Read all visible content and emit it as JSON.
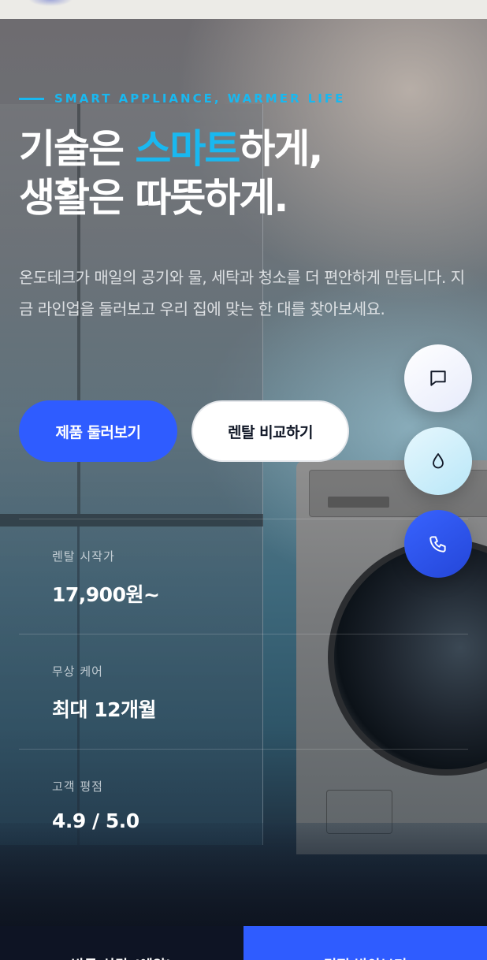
{
  "hero": {
    "eyebrow": "SMART APPLIANCE, WARMER LIFE",
    "headline_line1_before": "기술은 ",
    "headline_line1_accent": "스마트",
    "headline_line1_after": "하게,",
    "headline_line2": "생활은 따뜻하게.",
    "description": "온도테크가 매일의 공기와 물, 세탁과 청소를 더 편안하게 만듭니다. 지금 라인업을 둘러보고 우리 집에 맞는 한 대를 찾아보세요.",
    "primary_button": "제품 둘러보기",
    "secondary_button": "렌탈 비교하기"
  },
  "stats": [
    {
      "label": "렌탈 시작가",
      "value": "17,900원~"
    },
    {
      "label": "무상 케어",
      "value": "최대 12개월"
    },
    {
      "label": "고객 평점",
      "value": "4.9 / 5.0"
    }
  ],
  "fabs": [
    {
      "icon": "chat-bubble-icon"
    },
    {
      "icon": "water-drop-icon"
    },
    {
      "icon": "phone-icon"
    }
  ],
  "bottom_bar": {
    "left_label": "방문 상담 (예약)",
    "right_label": "견적 받아보기"
  },
  "colors": {
    "accent": "#19b8f0",
    "primary": "#2f5cff",
    "bottom_left": "#0e1424"
  }
}
